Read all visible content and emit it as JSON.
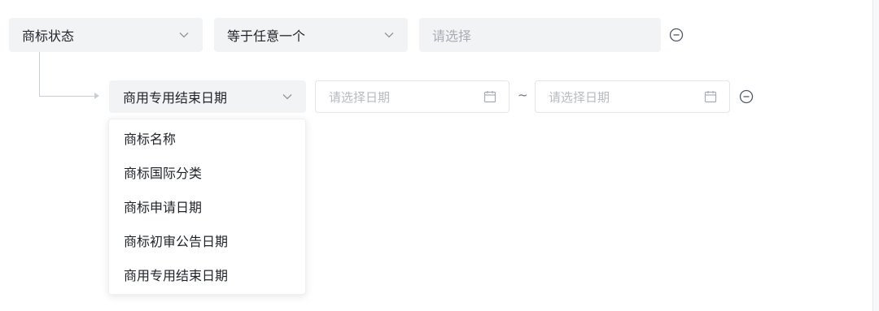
{
  "condition": {
    "field_select": {
      "value": "商标状态",
      "icon": "chevron-down-icon"
    },
    "operator_select": {
      "value": "等于任意一个",
      "icon": "chevron-down-icon"
    },
    "value_select": {
      "placeholder": "请选择"
    },
    "remove_icon": "minus-circle-icon"
  },
  "sub_condition": {
    "field_select": {
      "value": "商用专用结束日期",
      "icon": "chevron-down-icon"
    },
    "start_date": {
      "placeholder": "请选择日期",
      "icon": "calendar-icon"
    },
    "range_separator": "~",
    "end_date": {
      "placeholder": "请选择日期",
      "icon": "calendar-icon"
    },
    "remove_icon": "minus-circle-icon"
  },
  "dropdown": {
    "options": [
      "商标名称",
      "商标国际分类",
      "商标申请日期",
      "商标初审公告日期",
      "商用专用结束日期"
    ]
  },
  "colors": {
    "select_bg": "#f2f3f5",
    "placeholder": "#a8adb5",
    "border": "#e5e6eb",
    "connector": "#c9cdd4"
  }
}
